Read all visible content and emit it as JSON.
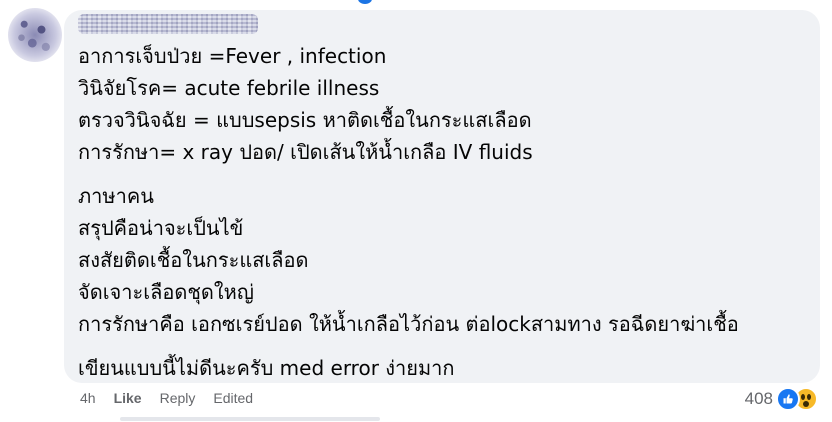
{
  "comment": {
    "author": "",
    "body": {
      "medical": [
        "อาการเจ็บป่วย =Fever , infection",
        "วินิจัยโรค= acute febrile illness",
        "ตรวจวินิจฉัย = แบบsepsis หาติดเชื้อในกระแสเลือด",
        "การรักษา= x ray ปอด/ เปิดเส้นให้น้ำเกลือ IV fluids"
      ],
      "plain": [
        "ภาษาคน",
        "สรุปคือน่าจะเป็นไข้",
        "สงสัยติดเชื้อในกระแสเลือด",
        "จัดเจาะเลือดชุดใหญ่",
        "การรักษาคือ เอกซเรย์ปอด ให้น้ำเกลือไว้ก่อน ต่อlockสามทาง รอฉีดยาฆ่าเชื้อ"
      ],
      "closing": "เขียนแบบนี้ไม่ดีนะครับ med error ง่ายมาก"
    },
    "actions": {
      "time": "4h",
      "like_label": "Like",
      "reply_label": "Reply",
      "edited_label": "Edited"
    },
    "reactions": {
      "count": "408",
      "icons": [
        "like-reaction-icon",
        "wow-reaction-icon"
      ],
      "like_color": "#1877f2",
      "wow_color": "#f7b928"
    }
  }
}
